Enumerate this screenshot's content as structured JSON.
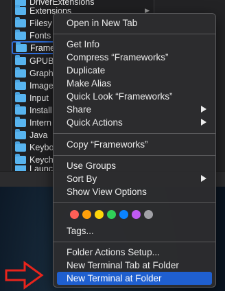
{
  "finder": {
    "top_partial": "DriverExtensions",
    "items": [
      {
        "name": "Extensions"
      },
      {
        "name": "Filesy"
      },
      {
        "name": "Fonts"
      },
      {
        "name": "Frame"
      },
      {
        "name": "GPUB"
      },
      {
        "name": "Graph"
      },
      {
        "name": "Image"
      },
      {
        "name": "Input"
      },
      {
        "name": "Install"
      },
      {
        "name": "Intern"
      },
      {
        "name": "Java"
      },
      {
        "name": "Keybo"
      },
      {
        "name": "Keych"
      },
      {
        "name": "Launc"
      }
    ]
  },
  "menu": {
    "open_new_tab": "Open in New Tab",
    "get_info": "Get Info",
    "compress": "Compress “Frameworks”",
    "duplicate": "Duplicate",
    "make_alias": "Make Alias",
    "quick_look": "Quick Look “Frameworks”",
    "share": "Share",
    "quick_actions": "Quick Actions",
    "copy": "Copy “Frameworks”",
    "use_groups": "Use Groups",
    "sort_by": "Sort By",
    "show_view_options": "Show View Options",
    "tags": "Tags...",
    "folder_actions_setup": "Folder Actions Setup...",
    "new_terminal_tab": "New Terminal Tab at Folder",
    "new_terminal": "New Terminal at Folder"
  },
  "tag_colors": [
    "#ff5f57",
    "#ff9f0a",
    "#ffd60a",
    "#30d158",
    "#0a84ff",
    "#bf5af2",
    "#a1a1a6"
  ],
  "annotation": {
    "arrow_icon": "red-outline-arrow-right",
    "color": "#e8241c"
  },
  "highlight_color": "#1f5fcf"
}
